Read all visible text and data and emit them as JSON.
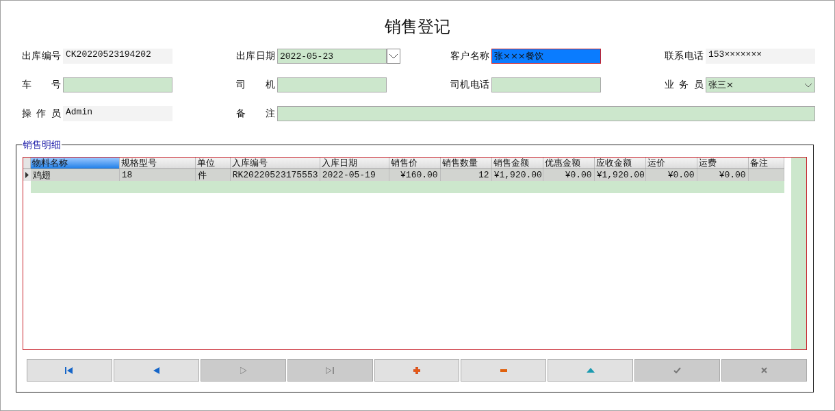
{
  "window": {
    "title": "销售登记"
  },
  "form_rows": [
    [
      {
        "label": "出库编号",
        "value": "CK20220523194202",
        "kind": "readonly"
      },
      {
        "label": "出库日期",
        "value": "2022-05-23",
        "kind": "date"
      },
      {
        "label": "客户名称",
        "value": "张×××餐饮",
        "kind": "highlighted"
      },
      {
        "label": "联系电话",
        "value": "153×××××××",
        "kind": "readonly"
      }
    ],
    [
      {
        "label": "车 号",
        "kind": "input"
      },
      {
        "label": "司 机",
        "kind": "input"
      },
      {
        "label": "司机电话",
        "kind": "input"
      },
      {
        "label": "业 务 员",
        "value": "张三×",
        "kind": "select"
      }
    ],
    [
      {
        "label": "操 作 员",
        "value": "Admin",
        "kind": "readonly"
      },
      {
        "label": "备 注",
        "kind": "input"
      }
    ]
  ],
  "details": {
    "title": "销售明细",
    "columns": [
      {
        "label": "物料名称",
        "selected": true
      },
      {
        "label": "规格型号",
        "selected": false
      },
      {
        "label": "单位",
        "selected": false
      },
      {
        "label": "入库编号",
        "selected": false
      },
      {
        "label": "入库日期",
        "selected": false
      },
      {
        "label": "销售价",
        "selected": false
      },
      {
        "label": "销售数量",
        "selected": false
      },
      {
        "label": "销售金额",
        "selected": false
      },
      {
        "label": "优惠金额",
        "selected": false
      },
      {
        "label": "应收金额",
        "selected": false
      },
      {
        "label": "运价",
        "selected": false
      },
      {
        "label": "运费",
        "selected": false
      },
      {
        "label": "备注",
        "selected": false
      }
    ],
    "rows": [
      {
        "selected": true,
        "cells": [
          "鸡翅",
          "18",
          "件",
          "RK20220523175553",
          "2022-05-19",
          "¥160.00",
          "12",
          "¥1,920.00",
          "¥0.00",
          "¥1,920.00",
          "¥0.00",
          "¥0.00",
          ""
        ]
      }
    ]
  },
  "nav_buttons": [
    {
      "kind": "first",
      "disabled": false
    },
    {
      "kind": "prev",
      "disabled": false
    },
    {
      "kind": "next",
      "disabled": true
    },
    {
      "kind": "last",
      "disabled": true
    },
    {
      "kind": "add",
      "disabled": false
    },
    {
      "kind": "remove",
      "disabled": false
    },
    {
      "kind": "up",
      "disabled": false
    },
    {
      "kind": "confirm",
      "disabled": true
    },
    {
      "kind": "cancel",
      "disabled": true
    }
  ]
}
